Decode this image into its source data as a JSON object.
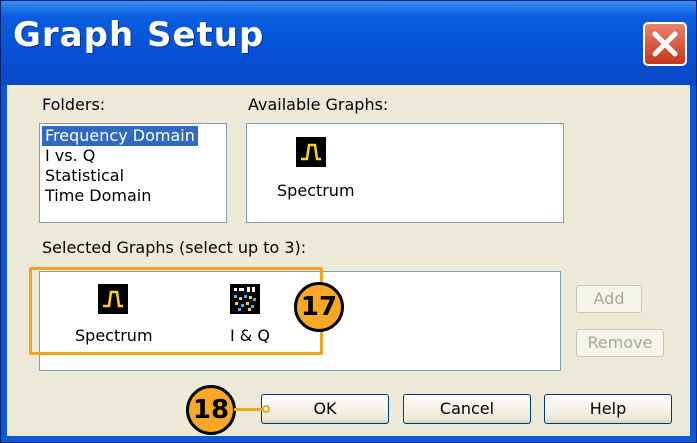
{
  "window": {
    "title": "Graph Setup",
    "close_icon": "close-icon"
  },
  "folders": {
    "label": "Folders:",
    "items": [
      "Frequency Domain",
      "I vs. Q",
      "Statistical",
      "Time Domain"
    ],
    "selected": "Frequency Domain"
  },
  "available": {
    "label": "Available Graphs:",
    "items": [
      {
        "label": "Spectrum",
        "icon": "spectrum-icon"
      }
    ]
  },
  "selected_graphs": {
    "label": "Selected Graphs (select up to 3):",
    "items": [
      {
        "label": "Spectrum",
        "icon": "spectrum-icon"
      },
      {
        "label": "I & Q",
        "icon": "iq-icon"
      }
    ]
  },
  "buttons": {
    "add": "Add",
    "remove": "Remove",
    "ok": "OK",
    "cancel": "Cancel",
    "help": "Help"
  },
  "callouts": {
    "selected_graphs": "17",
    "ok": "18"
  },
  "colors": {
    "title_bar": "#0750d6",
    "selection": "#316ac5",
    "callout": "#f9a825",
    "dialog_bg": "#ece9d8"
  }
}
